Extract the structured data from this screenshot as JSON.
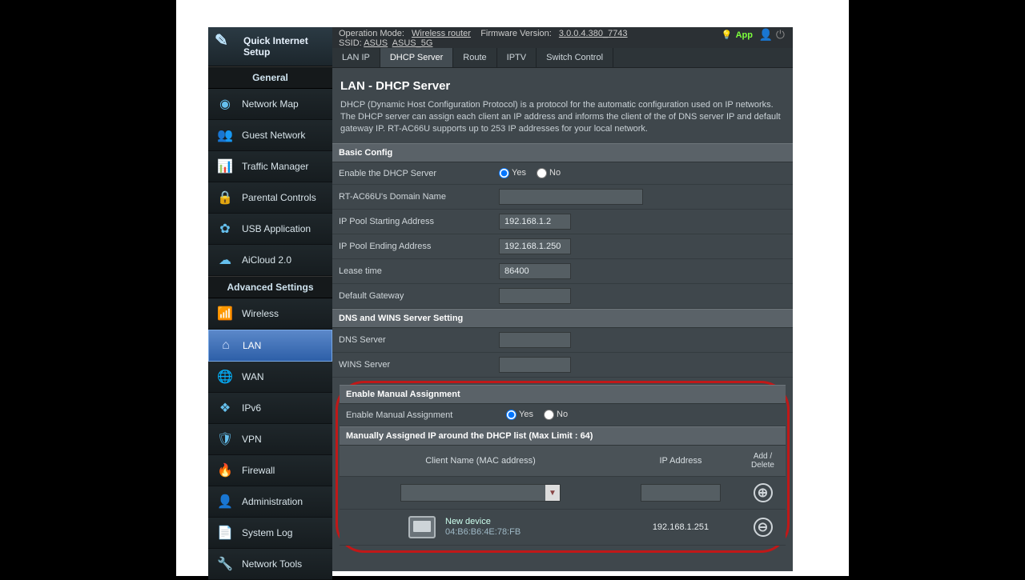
{
  "header": {
    "op_mode_label": "Operation Mode:",
    "op_mode_value": "Wireless router",
    "fw_label": "Firmware Version:",
    "fw_value": "3.0.0.4.380_7743",
    "ssid_label": "SSID:",
    "ssid1": "ASUS",
    "ssid2": "ASUS_5G",
    "app_label": "App"
  },
  "sidebar": {
    "qis_line1": "Quick Internet",
    "qis_line2": "Setup",
    "general_title": "General",
    "general": [
      {
        "label": "Network Map"
      },
      {
        "label": "Guest Network"
      },
      {
        "label": "Traffic Manager"
      },
      {
        "label": "Parental Controls"
      },
      {
        "label": "USB Application"
      },
      {
        "label": "AiCloud 2.0"
      }
    ],
    "advanced_title": "Advanced Settings",
    "advanced": [
      {
        "label": "Wireless"
      },
      {
        "label": "LAN"
      },
      {
        "label": "WAN"
      },
      {
        "label": "IPv6"
      },
      {
        "label": "VPN"
      },
      {
        "label": "Firewall"
      },
      {
        "label": "Administration"
      },
      {
        "label": "System Log"
      },
      {
        "label": "Network Tools"
      }
    ]
  },
  "tabs": [
    "LAN IP",
    "DHCP Server",
    "Route",
    "IPTV",
    "Switch Control"
  ],
  "page": {
    "title": "LAN - DHCP Server",
    "desc": "DHCP (Dynamic Host Configuration Protocol) is a protocol for the automatic configuration used on IP networks. The DHCP server can assign each client an IP address and informs the client of the of DNS server IP and default gateway IP. RT-AC66U supports up to 253 IP addresses for your local network."
  },
  "basic": {
    "head": "Basic Config",
    "enable_label": "Enable the DHCP Server",
    "yes": "Yes",
    "no": "No",
    "domain_label": "RT-AC66U's Domain Name",
    "domain_value": "",
    "pool_start_label": "IP Pool Starting Address",
    "pool_start_value": "192.168.1.2",
    "pool_end_label": "IP Pool Ending Address",
    "pool_end_value": "192.168.1.250",
    "lease_label": "Lease time",
    "lease_value": "86400",
    "gateway_label": "Default Gateway",
    "gateway_value": ""
  },
  "dnswins": {
    "head": "DNS and WINS Server Setting",
    "dns_label": "DNS Server",
    "dns_value": "",
    "wins_label": "WINS Server",
    "wins_value": ""
  },
  "manual": {
    "head": "Enable Manual Assignment",
    "enable_label": "Enable Manual Assignment",
    "yes": "Yes",
    "no": "No",
    "list_head": "Manually Assigned IP around the DHCP list (Max Limit : 64)",
    "col_client": "Client Name (MAC address)",
    "col_ip": "IP Address",
    "col_action": "Add / Delete",
    "new_client": "",
    "new_ip": "",
    "device_name": "New device",
    "device_mac": "04:B6:B6:4E:78:FB",
    "device_ip": "192.168.1.251"
  }
}
